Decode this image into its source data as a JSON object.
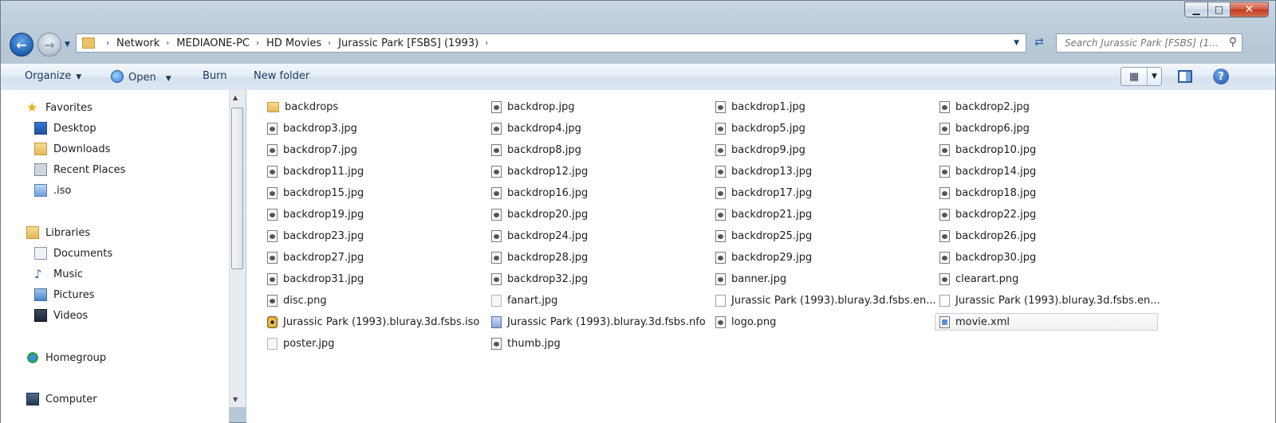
{
  "window": {
    "caption_buttons": {
      "minimize": "▁",
      "maximize": "□",
      "close": "✕"
    }
  },
  "address": {
    "crumbs": [
      "Network",
      "MEDIAONE-PC",
      "HD Movies",
      "Jurassic Park [FSBS] (1993)"
    ],
    "separator": "›"
  },
  "search": {
    "placeholder": "Search Jurassic Park [FSBS] (1..."
  },
  "toolbar": {
    "organize": "Organize",
    "open": "Open",
    "burn": "Burn",
    "new_folder": "New folder",
    "help": "?"
  },
  "nav": {
    "favorites": "Favorites",
    "desktop": "Desktop",
    "downloads": "Downloads",
    "recent_places": "Recent Places",
    "iso": ".iso",
    "libraries": "Libraries",
    "documents": "Documents",
    "music": "Music",
    "pictures": "Pictures",
    "videos": "Videos",
    "homegroup": "Homegroup",
    "computer": "Computer"
  },
  "files": [
    {
      "name": "backdrops",
      "icon": "folder"
    },
    {
      "name": "backdrop.jpg",
      "icon": "jpg"
    },
    {
      "name": "backdrop1.jpg",
      "icon": "jpg"
    },
    {
      "name": "backdrop2.jpg",
      "icon": "jpg"
    },
    {
      "name": "backdrop3.jpg",
      "icon": "jpg"
    },
    {
      "name": "backdrop4.jpg",
      "icon": "jpg"
    },
    {
      "name": "backdrop5.jpg",
      "icon": "jpg"
    },
    {
      "name": "backdrop6.jpg",
      "icon": "jpg"
    },
    {
      "name": "backdrop7.jpg",
      "icon": "jpg"
    },
    {
      "name": "backdrop8.jpg",
      "icon": "jpg"
    },
    {
      "name": "backdrop9.jpg",
      "icon": "jpg"
    },
    {
      "name": "backdrop10.jpg",
      "icon": "jpg"
    },
    {
      "name": "backdrop11.jpg",
      "icon": "jpg"
    },
    {
      "name": "backdrop12.jpg",
      "icon": "jpg"
    },
    {
      "name": "backdrop13.jpg",
      "icon": "jpg"
    },
    {
      "name": "backdrop14.jpg",
      "icon": "jpg"
    },
    {
      "name": "backdrop15.jpg",
      "icon": "jpg"
    },
    {
      "name": "backdrop16.jpg",
      "icon": "jpg"
    },
    {
      "name": "backdrop17.jpg",
      "icon": "jpg"
    },
    {
      "name": "backdrop18.jpg",
      "icon": "jpg"
    },
    {
      "name": "backdrop19.jpg",
      "icon": "jpg"
    },
    {
      "name": "backdrop20.jpg",
      "icon": "jpg"
    },
    {
      "name": "backdrop21.jpg",
      "icon": "jpg"
    },
    {
      "name": "backdrop22.jpg",
      "icon": "jpg"
    },
    {
      "name": "backdrop23.jpg",
      "icon": "jpg"
    },
    {
      "name": "backdrop24.jpg",
      "icon": "jpg"
    },
    {
      "name": "backdrop25.jpg",
      "icon": "jpg"
    },
    {
      "name": "backdrop26.jpg",
      "icon": "jpg"
    },
    {
      "name": "backdrop27.jpg",
      "icon": "jpg"
    },
    {
      "name": "backdrop28.jpg",
      "icon": "jpg"
    },
    {
      "name": "backdrop29.jpg",
      "icon": "jpg"
    },
    {
      "name": "backdrop30.jpg",
      "icon": "jpg"
    },
    {
      "name": "backdrop31.jpg",
      "icon": "jpg"
    },
    {
      "name": "backdrop32.jpg",
      "icon": "jpg"
    },
    {
      "name": "banner.jpg",
      "icon": "jpg"
    },
    {
      "name": "clearart.png",
      "icon": "jpg"
    },
    {
      "name": "disc.png",
      "icon": "jpg"
    },
    {
      "name": "fanart.jpg",
      "icon": "fanart"
    },
    {
      "name": "Jurassic Park (1993).bluray.3d.fsbs.en...",
      "icon": "blank"
    },
    {
      "name": "Jurassic Park (1993).bluray.3d.fsbs.en...",
      "icon": "blank"
    },
    {
      "name": "Jurassic Park (1993).bluray.3d.fsbs.iso",
      "icon": "iso"
    },
    {
      "name": "Jurassic Park (1993).bluray.3d.fsbs.nfo",
      "icon": "nfo"
    },
    {
      "name": "logo.png",
      "icon": "jpg"
    },
    {
      "name": "movie.xml",
      "icon": "xml",
      "selected": true
    },
    {
      "name": "poster.jpg",
      "icon": "fanart"
    },
    {
      "name": "thumb.jpg",
      "icon": "jpg"
    }
  ]
}
